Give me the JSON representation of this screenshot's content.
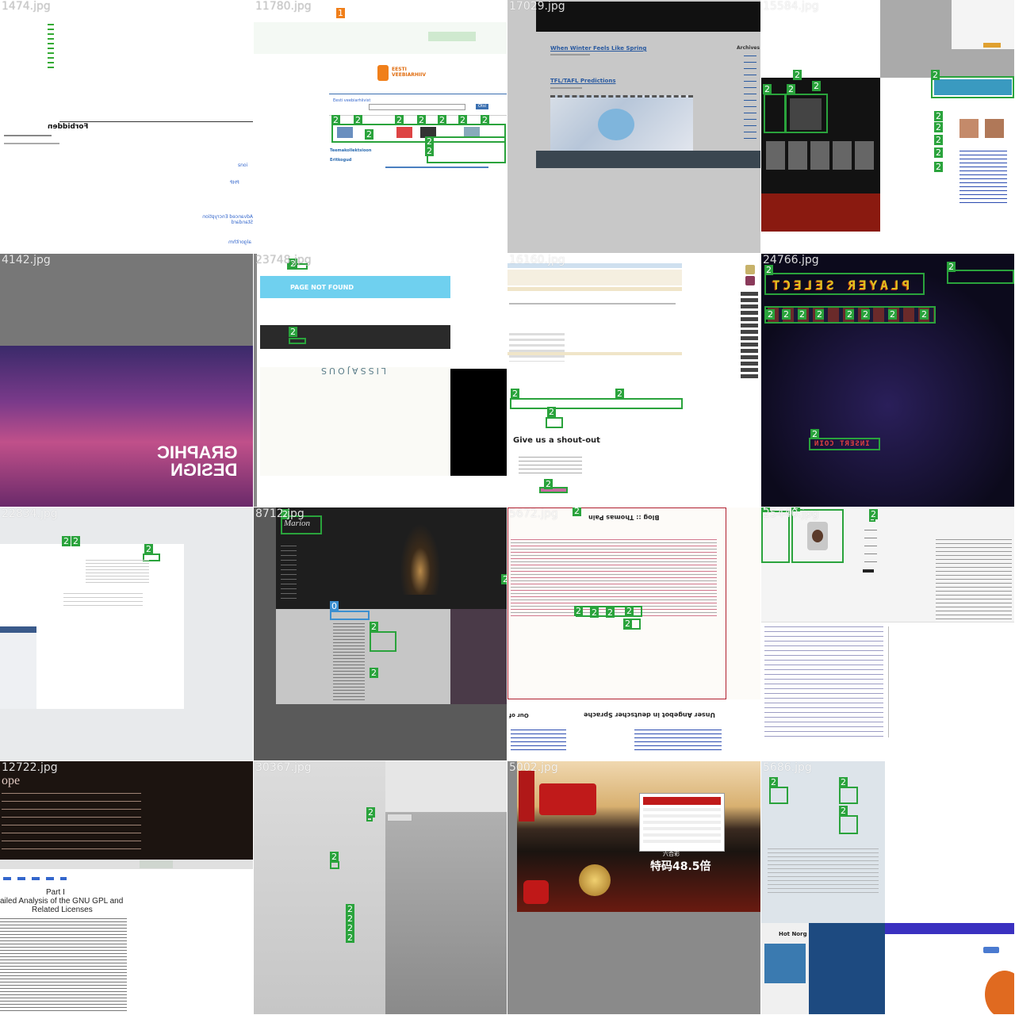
{
  "tiles": [
    {
      "filename": "1474.jpg"
    },
    {
      "filename": "11780.jpg"
    },
    {
      "filename": "17029.jpg"
    },
    {
      "filename": "15584.jpg"
    },
    {
      "filename": "4142.jpg"
    },
    {
      "filename": "23748.jpg"
    },
    {
      "filename": "16160.jpg"
    },
    {
      "filename": "24766.jpg"
    },
    {
      "filename": "22834.jpg"
    },
    {
      "filename": "8712.jpg"
    },
    {
      "filename": "5672.jpg"
    },
    {
      "filename": "25440.jpg"
    },
    {
      "filename": "12722.jpg"
    },
    {
      "filename": "30367.jpg"
    },
    {
      "filename": "5002.jpg"
    },
    {
      "filename": "5686.jpg"
    }
  ],
  "t1": {
    "heading": "Forbidden",
    "links": [
      "Advanced Encryption Standard",
      "algorithm",
      "PHP"
    ]
  },
  "t2": {
    "brand": "EESTI VEEBIARHIIV",
    "link1": "Teemakollektsioon",
    "link2": "Eritkogud",
    "search_btn": "Otsi"
  },
  "t3": {
    "post1": "When Winter Feels Like Spring",
    "post2": "TFL/TAFL Predictions",
    "sidebar": "Archives"
  },
  "t5": {
    "line1": "GRAPHIC",
    "line2": "DESIGN"
  },
  "t6": {
    "banner": "PAGE NOT FOUND",
    "brand": "LISSAJOUS"
  },
  "t7": {
    "shout": "Give us a shout-out"
  },
  "t8": {
    "title": "PLAYER SELECT",
    "coin": "INSERT COIN"
  },
  "t10": {
    "logo": "Marion"
  },
  "t11": {
    "title": "Blog :: Thomas Pain",
    "offer": "Unser Angebot in deutscher Sprache"
  },
  "t13": {
    "part": "Part I",
    "sub1": "ailed Analysis of the GNU GPL and",
    "sub2": "Related Licenses",
    "top": "ope"
  },
  "t15": {
    "big": "特码48.5倍",
    "six": "六合彩"
  },
  "t16": {
    "news": "Hot Norg"
  },
  "badges": {
    "two": "2",
    "zero": "0",
    "one": "1"
  }
}
